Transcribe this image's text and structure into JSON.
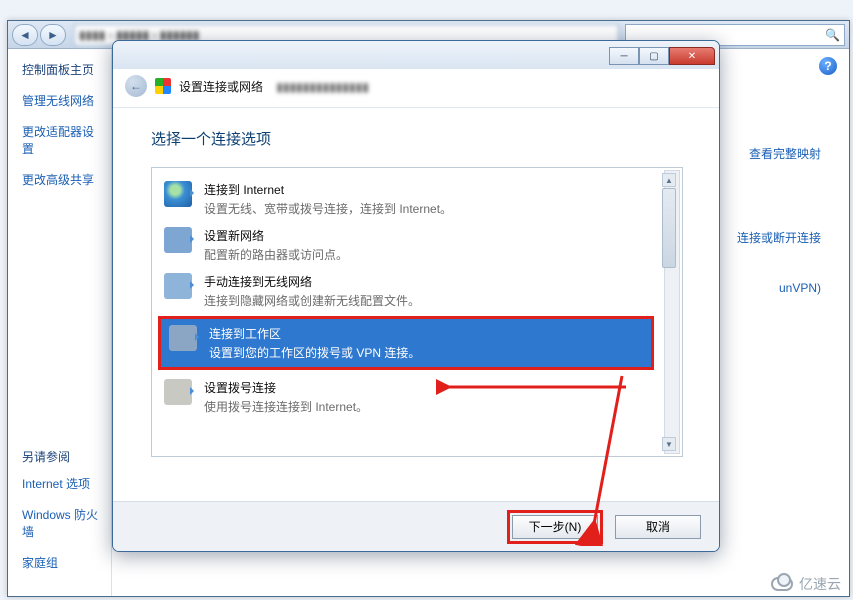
{
  "explorer": {
    "sidebar": {
      "header": "控制面板主页",
      "links": [
        "管理无线网络",
        "更改适配器设置",
        "更改高级共享"
      ],
      "seeAlsoHeader": "另请参阅",
      "seeAlsoLinks": [
        "Internet 选项",
        "Windows 防火墙",
        "家庭组"
      ]
    },
    "rightLinks": {
      "mapLink": "查看完整映射",
      "connLink": "连接或断开连接",
      "vpnLink": "unVPN)"
    }
  },
  "dialog": {
    "windowTitle": "设置连接或网络",
    "subtitle": "选择一个连接选项",
    "options": [
      {
        "id": "internet",
        "title": "连接到 Internet",
        "desc": "设置无线、宽带或拨号连接，连接到 Internet。"
      },
      {
        "id": "newnet",
        "title": "设置新网络",
        "desc": "配置新的路由器或访问点。"
      },
      {
        "id": "wifi",
        "title": "手动连接到无线网络",
        "desc": "连接到隐藏网络或创建新无线配置文件。"
      },
      {
        "id": "work",
        "title": "连接到工作区",
        "desc": "设置到您的工作区的拨号或 VPN 连接。",
        "selected": true
      },
      {
        "id": "dialup",
        "title": "设置拨号连接",
        "desc": "使用拨号连接连接到 Internet。"
      }
    ],
    "buttons": {
      "next": "下一步(N)",
      "cancel": "取消"
    }
  },
  "watermark": "亿速云"
}
